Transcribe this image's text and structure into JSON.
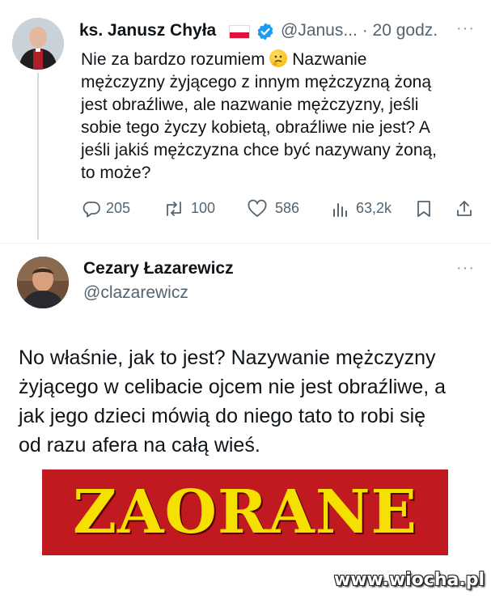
{
  "tweet1": {
    "author_name": "ks. Janusz Chyła",
    "handle": "@Janus...",
    "dot": "·",
    "time": "20 godz.",
    "text_before_emoji": "Nie za bardzo rozumiem ",
    "text_after_emoji": " Nazwanie\nmężczyzny żyjącego z innym mężczyzną żoną\njest obraźliwe, ale nazwanie mężczyzny, jeśli\nsobie tego życzy kobietą, obraźliwe nie jest? A\njeśli jakiś mężczyzna chce być nazywany żoną,\nto może?",
    "emoji": "thinking-face",
    "stats": {
      "replies": "205",
      "reposts": "100",
      "likes": "586",
      "views": "63,2k"
    },
    "icons": {
      "reply": "reply-icon",
      "repost": "repost-icon",
      "like": "heart-icon",
      "views": "views-icon",
      "bookmark": "bookmark-icon",
      "share": "share-icon",
      "verified": "verified-badge-icon",
      "flag": "poland-flag-icon",
      "more": "more-options-icon"
    }
  },
  "tweet2": {
    "author_name": "Cezary Łazarewicz",
    "handle": "@clazarewicz",
    "text": "No właśnie, jak to jest? Nazywanie mężczyzny\nżyjącego w celibacie ojcem nie jest obraźliwe, a\njak jego dzieci mówią do niego tato to robi się\nod razu afera na całą wieś."
  },
  "banner": {
    "text": "ZAORANE",
    "background": "#c0191f",
    "text_color": "#f5e000"
  },
  "watermark": "www.wiocha.pl",
  "colors": {
    "verified": "#1d9bf0",
    "secondary_text": "#536471",
    "text": "#0f1419"
  }
}
